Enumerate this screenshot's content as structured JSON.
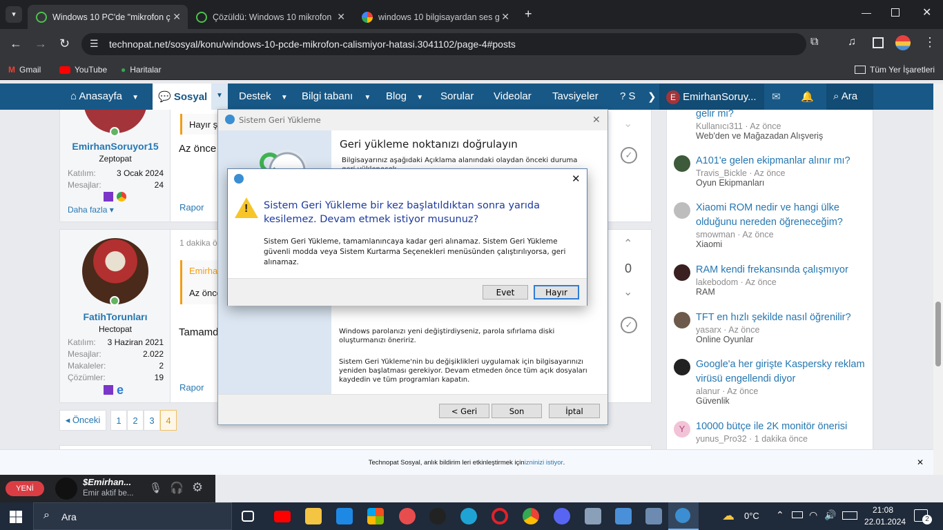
{
  "browser": {
    "tabs": [
      {
        "title": "Windows 10 PC'de \"mikrofon ç",
        "active": true
      },
      {
        "title": "Çözüldü: Windows 10 mikrofon",
        "active": false
      },
      {
        "title": "windows 10 bilgisayardan ses g",
        "active": false
      }
    ],
    "url": "technopat.net/sosyal/konu/windows-10-pcde-mikrofon-calismiyor-hatasi.3041102/page-4#posts",
    "bookmarks": [
      "Gmail",
      "YouTube",
      "Haritalar"
    ],
    "all_bookmarks": "Tüm Yer İşaretleri"
  },
  "site_nav": {
    "items": [
      "Anasayfa",
      "Sosyal",
      "Destek",
      "Bilgi tabanı",
      "Blog",
      "Sorular",
      "Videolar",
      "Tavsiyeler",
      "S"
    ],
    "user": "EmirhanSoruy...",
    "user_initial": "E",
    "search": "Ara"
  },
  "posts": [
    {
      "user": "EmirhanSoruyor15",
      "role": "Zeptopat",
      "stats": [
        [
          "Katılım:",
          "3 Ocak 2024"
        ],
        [
          "Mesajlar:",
          "24"
        ]
      ],
      "more": "Daha fazla",
      "quote": "Hayır şu",
      "body": "Az önce",
      "report": "Rapor"
    },
    {
      "user": "FatihTorunları",
      "role": "Hectopat",
      "stats": [
        [
          "Katılım:",
          "3 Haziran 2021"
        ],
        [
          "Mesajlar:",
          "2.022"
        ],
        [
          "Makaleler:",
          "2"
        ],
        [
          "Çözümler:",
          "19"
        ]
      ],
      "time": "1 dakika ön",
      "quote_author": "Emirhan",
      "quote": "Az önce",
      "body": "Tamamd",
      "report": "Rapor",
      "votes": "0"
    }
  ],
  "pagination": {
    "prev": "◂ Önceki",
    "pages": [
      "1",
      "2",
      "3",
      "4"
    ],
    "current": "4"
  },
  "sidebar": [
    {
      "title": "gelir mi?",
      "meta": "Kullanıcı311 · Az önce",
      "cat": "Web'den ve Mağazadan Alışveriş"
    },
    {
      "title": "A101'e gelen ekipmanlar alınır mı?",
      "meta": "Travis_Bickle · Az önce",
      "cat": "Oyun Ekipmanları"
    },
    {
      "title": "Xiaomi ROM nedir ve hangi ülke olduğunu nereden öğreneceğim?",
      "meta": "smowman · Az önce",
      "cat": "Xiaomi"
    },
    {
      "title": "RAM kendi frekansında çalışmıyor",
      "meta": "lakebodom · Az önce",
      "cat": "RAM"
    },
    {
      "title": "TFT en hızlı şekilde nasıl öğrenilir?",
      "meta": "yasarx · Az önce",
      "cat": "Online Oyunlar"
    },
    {
      "title": "Google'a her girişte Kaspersky reklam virüsü engellendi diyor",
      "meta": "alanur · Az önce",
      "cat": "Güvenlik"
    },
    {
      "title": "10000 bütçe ile 2K monitör önerisi",
      "meta": "yunus_Pro32 · 1 dakika önce",
      "cat": "",
      "initial": "Y"
    }
  ],
  "notice": {
    "text": "Technopat Sosyal, anlık bildirim leri etkinleştirmek için ",
    "link": "izninizi istiyor",
    "end": "."
  },
  "wizard": {
    "title": "Sistem Geri Yükleme",
    "heading": "Geri yükleme noktanızı doğrulayın",
    "intro": "Bilgisayarınız aşağıdaki Açıklama alanındaki olaydan önceki duruma geri yüklenecek.",
    "para1": "Windows parolanızı yeni değiştirdiyseniz, parola sıfırlama diski oluşturmanızı öneririz.",
    "para2": "Sistem Geri Yükleme'nin bu değişiklikleri uygulamak için bilgisayarınızı yeniden başlatması gerekiyor. Devam etmeden önce tüm açık dosyaları kaydedin ve tüm programları kapatın.",
    "back": "< Geri",
    "finish": "Son",
    "cancel": "İptal"
  },
  "confirm": {
    "heading": "Sistem Geri Yükleme bir kez başlatıldıktan sonra yarıda kesilemez. Devam etmek istiyor musunuz?",
    "body": "Sistem Geri Yükleme, tamamlanıncaya kadar geri alınamaz. Sistem Geri Yükleme güvenli modda veya Sistem Kurtarma Seçenekleri menüsünden çalıştırılıyorsa, geri alınamaz.",
    "yes": "Evet",
    "no": "Hayır"
  },
  "discord": {
    "badge": "YENİ",
    "name": "$Emirhan...",
    "status": "Emir aktif be..."
  },
  "taskbar": {
    "search": "Ara",
    "temp": "0°C",
    "time": "21:08",
    "date": "22.01.2024",
    "notif": "2"
  },
  "colors": {
    "accent": "#185886",
    "link": "#2577b1",
    "dialog_heading": "#1c3a9f"
  }
}
